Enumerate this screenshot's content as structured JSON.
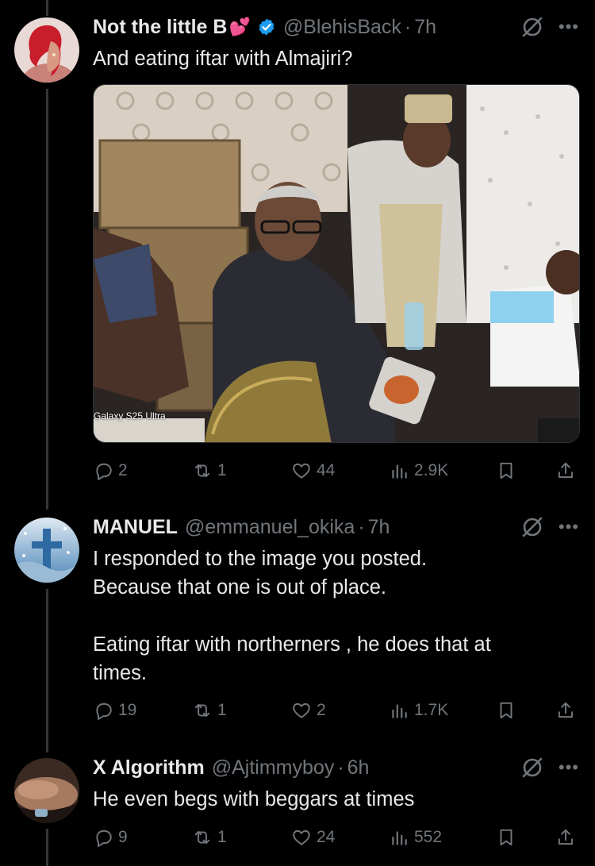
{
  "tweets": [
    {
      "name": "Not the little B",
      "name_emoji": "💕",
      "handle": "@BlehisBack",
      "time": "7h",
      "text": "And eating iftar with Almajiri?",
      "image_caption": "Galaxy S25 Ultra",
      "replies": "2",
      "reposts": "1",
      "likes": "44",
      "views": "2.9K"
    },
    {
      "name": "MANUEL",
      "handle": "@emmanuel_okika",
      "time": "7h",
      "text": "I responded to the image you posted.\nBecause that one is out of place.\n\nEating iftar with northerners , he does that at\ntimes.",
      "replies": "19",
      "reposts": "1",
      "likes": "2",
      "views": "1.7K"
    },
    {
      "name": "X Algorithm",
      "handle": "@Ajtimmyboy",
      "time": "6h",
      "text": "He even begs with beggars at times",
      "replies": "9",
      "reposts": "1",
      "likes": "24",
      "views": "552"
    }
  ],
  "colors": {
    "background": "#000000",
    "text": "#e7e9ea",
    "muted": "#71767b",
    "verified": "#1d9bf0"
  },
  "icons": [
    "verified-badge-icon",
    "grok-icon",
    "more-icon",
    "reply-icon",
    "repost-icon",
    "like-icon",
    "views-icon",
    "bookmark-icon",
    "share-icon"
  ]
}
